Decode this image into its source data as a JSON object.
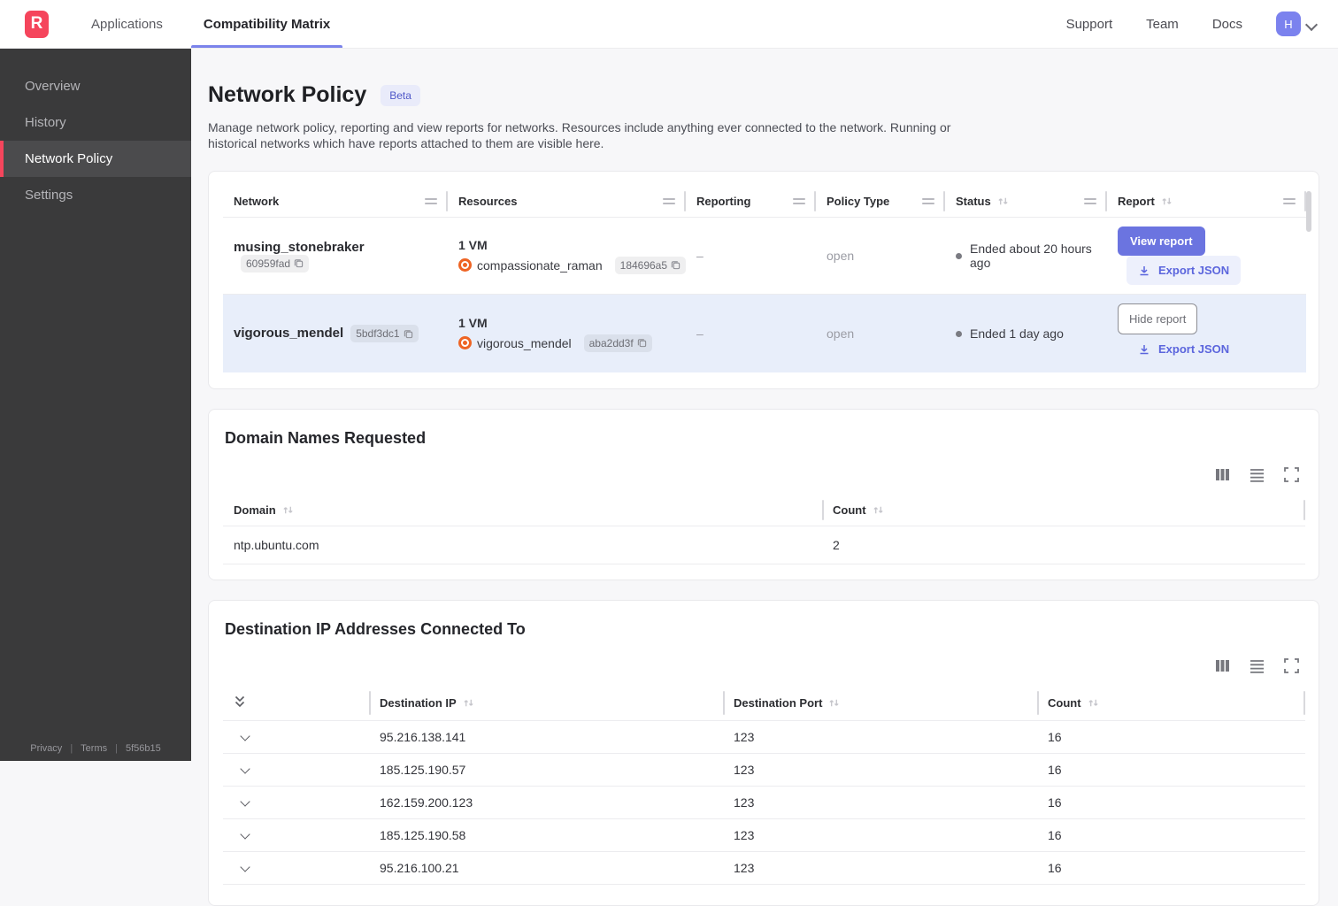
{
  "navbar": {
    "logo_letter": "R",
    "tabs": [
      {
        "label": "Applications",
        "active": false
      },
      {
        "label": "Compatibility Matrix",
        "active": true
      }
    ],
    "links": {
      "support": "Support",
      "team": "Team",
      "docs": "Docs"
    },
    "avatar_letter": "H"
  },
  "sidebar": {
    "items": [
      {
        "label": "Overview",
        "active": false
      },
      {
        "label": "History",
        "active": false
      },
      {
        "label": "Network Policy",
        "active": true
      },
      {
        "label": "Settings",
        "active": false
      }
    ],
    "footer": {
      "privacy": "Privacy",
      "terms": "Terms",
      "build": "5f56b15"
    }
  },
  "page": {
    "title": "Network Policy",
    "badge": "Beta",
    "description": "Manage network policy, reporting and view reports for networks. Resources include anything ever connected to the network. Running or historical networks which have reports attached to them are visible here."
  },
  "network_table": {
    "columns": [
      "Network",
      "Resources",
      "Reporting",
      "Policy Type",
      "Status",
      "Report"
    ],
    "rows": [
      {
        "name": "musing_stonebraker",
        "hash": "60959fad",
        "vm_count": "1 VM",
        "resource_name": "compassionate_raman",
        "resource_hash": "184696a5",
        "reporting": "–",
        "policy_type": "open",
        "status": "Ended about 20 hours ago",
        "report_button": "View report",
        "export_label": "Export JSON"
      },
      {
        "name": "vigorous_mendel",
        "hash": "5bdf3dc1",
        "vm_count": "1 VM",
        "resource_name": "vigorous_mendel",
        "resource_hash": "aba2dd3f",
        "reporting": "–",
        "policy_type": "open",
        "status": "Ended 1 day ago",
        "report_button": "Hide report",
        "export_label": "Export JSON"
      }
    ]
  },
  "domains_card": {
    "title": "Domain Names Requested",
    "columns": [
      "Domain",
      "Count"
    ],
    "rows": [
      {
        "domain": "ntp.ubuntu.com",
        "count": "2"
      }
    ]
  },
  "destinations_card": {
    "title": "Destination IP Addresses Connected To",
    "columns": [
      "Destination IP",
      "Destination Port",
      "Count"
    ],
    "rows": [
      {
        "ip": "95.216.138.141",
        "port": "123",
        "count": "16"
      },
      {
        "ip": "185.125.190.57",
        "port": "123",
        "count": "16"
      },
      {
        "ip": "162.159.200.123",
        "port": "123",
        "count": "16"
      },
      {
        "ip": "185.125.190.58",
        "port": "123",
        "count": "16"
      },
      {
        "ip": "95.216.100.21",
        "port": "123",
        "count": "16"
      }
    ]
  },
  "colors": {
    "accent_indigo": "#6b74e0",
    "brand_red": "#f5455c",
    "row_highlight": "#e8eefa",
    "ubuntu_orange": "#ee6424"
  }
}
